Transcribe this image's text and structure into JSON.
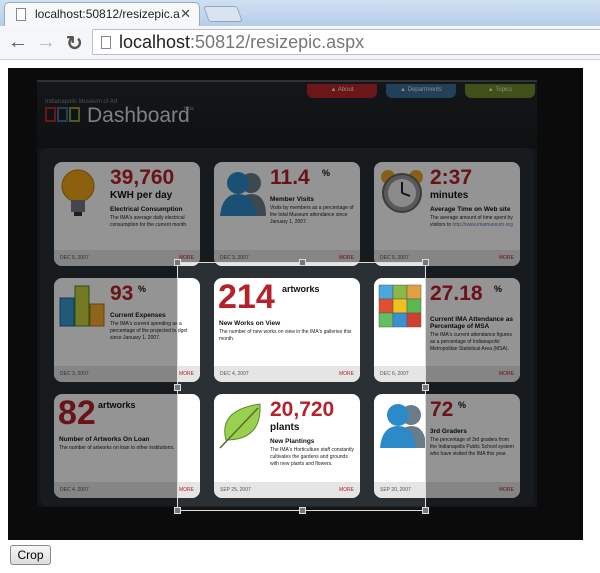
{
  "browser": {
    "tab_title": "localhost:50812/resizepic.a",
    "url_host": "localhost",
    "url_rest": ":50812/resizepic.aspx"
  },
  "header": {
    "org": "Indianapolis Museum of Art",
    "title": "Dashboard",
    "beta": "beta",
    "tabs": [
      {
        "label": "▲ About",
        "color": "#b8262b"
      },
      {
        "label": "▲ Departments",
        "color": "#3b6e98"
      },
      {
        "label": "▲ Topics",
        "color": "#6f8a2a"
      }
    ]
  },
  "cards": [
    {
      "big": "39,760",
      "unit": "KWH per day",
      "title": "Electrical Consumption",
      "desc": "The IMA's average daily electrical consumption for the current month.",
      "date": "DEC 6, 2007",
      "more": "MORE",
      "icon": "lightbulb-icon"
    },
    {
      "big": "11.4",
      "unit": "%",
      "title": "Member Visits",
      "desc": "Visits by members as a percentage of the total Museum attendance since January 1, 2007.",
      "date": "DEC 3, 2007",
      "more": "MORE",
      "icon": "people-icon"
    },
    {
      "big": "2:37",
      "unit": "minutes",
      "title": "Average Time on Web site",
      "desc": "The average amount of time spent by visitors to",
      "link": "http://www.imamuseum.org",
      "date": "DEC 6, 2007",
      "more": "MORE",
      "icon": "clock-icon"
    },
    {
      "big": "93",
      "unit": "%",
      "title": "Current Expenses",
      "desc": "The IMA's current spending as a percentage of the projected budget since January 1, 2007.",
      "date": "DEC 3, 2007",
      "more": "MORE",
      "icon": "bar-chart-icon"
    },
    {
      "big": "214",
      "unit": "artworks",
      "title": "New Works on View",
      "desc": "The number of new works on view in the IMA's galleries this month.",
      "date": "DEC 4, 2007",
      "more": "MORE"
    },
    {
      "big": "27.18",
      "unit": "%",
      "title": "Current IMA Attendance as Percentage of MSA",
      "desc": "The IMA's current attendance figures as a percentage of Indianapolis' Metropolitan Statistical Area (MSA).",
      "date": "DEC 6, 2007",
      "more": "MORE",
      "icon": "color-grid-icon"
    },
    {
      "big": "82",
      "unit": "artworks",
      "title": "Number of Artworks On Loan",
      "desc": "The number of artworks on loan to other institutions.",
      "date": "DEC 4, 2007",
      "more": "MORE"
    },
    {
      "big": "20,720",
      "unit": "plants",
      "title": "New Plantings",
      "desc": "The IMA's Horticulture staff constantly cultivates the gardens and grounds with new plants and flowers.",
      "date": "SEP 25, 2007",
      "more": "MORE",
      "icon": "leaf-icon"
    },
    {
      "big": "72",
      "unit": "%",
      "title": "3rd Graders",
      "desc": "The percentage of 3rd graders from the Indianapolis Public School system who have visited the IMA this year.",
      "date": "SEP 20, 2007",
      "more": "MORE",
      "icon": "people-icon"
    }
  ],
  "crop_button": "Crop"
}
